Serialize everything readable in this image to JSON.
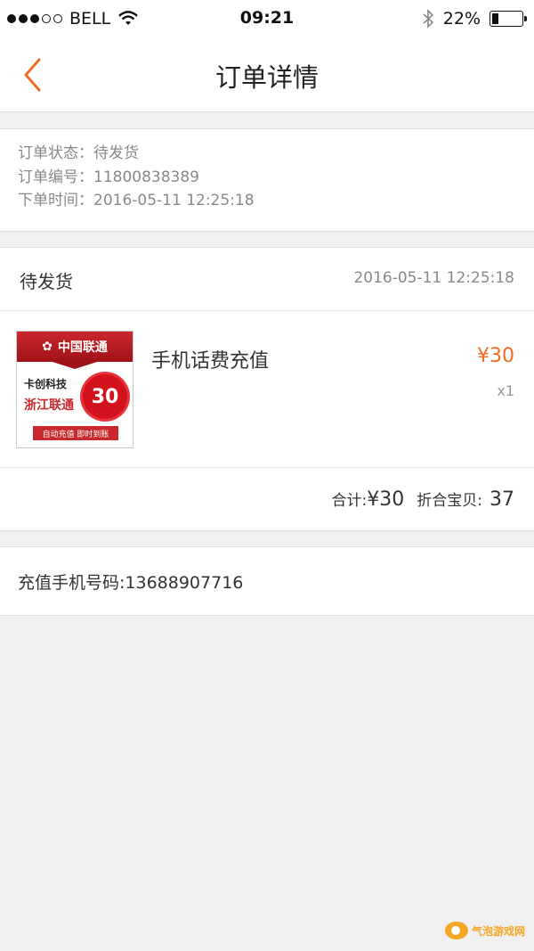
{
  "status_bar": {
    "carrier": "BELL",
    "time": "09:21",
    "battery": "22%",
    "signal_bars": 3,
    "signal_total": 5
  },
  "nav": {
    "title": "订单详情",
    "back_icon": "chevron-left-icon",
    "accent_color": "#f26b22"
  },
  "order_info": {
    "status": "订单状态：待发货",
    "number": "订单编号：11800838389",
    "time": "下单时间：2016-05-11 12:25:18"
  },
  "order": {
    "status": "待发货",
    "time": "2016-05-11 12:25:18",
    "product": {
      "name": "手机话费充值",
      "price": "¥30",
      "quantity": "x1",
      "image": {
        "banner": "中国联通",
        "brand": "卡创科技",
        "province": "浙江联通",
        "badge": "30",
        "footer": "自动充值 即时到账"
      }
    },
    "total_label": "合计:",
    "total_value": "¥30",
    "points_label": "折合宝贝:",
    "points_value": "37"
  },
  "recharge": {
    "phone": "充值手机号码:13688907716"
  },
  "watermark": {
    "text": "气泡游戏网"
  }
}
